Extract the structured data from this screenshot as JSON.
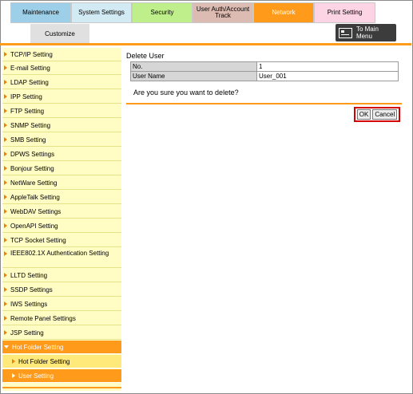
{
  "tabs": {
    "maintenance": "Maintenance",
    "system_settings": "System Settings",
    "security": "Security",
    "user_auth": "User Auth/Account Track",
    "network": "Network",
    "print_setting": "Print Setting"
  },
  "subtab": {
    "customize": "Customize"
  },
  "to_main_menu": "To Main Menu",
  "sidebar": {
    "items": [
      "TCP/IP Setting",
      "E-mail Setting",
      "LDAP Setting",
      "IPP Setting",
      "FTP Setting",
      "SNMP Setting",
      "SMB Setting",
      "DPWS Settings",
      "Bonjour Setting",
      "NetWare Setting",
      "AppleTalk Setting",
      "WebDAV Settings",
      "OpenAPI Setting",
      "TCP Socket Setting",
      "IEEE802.1X Authentication Setting",
      "LLTD Setting",
      "SSDP Settings",
      "IWS Settings",
      "Remote Panel Settings",
      "JSP Setting",
      "Hot Folder Setting"
    ],
    "sub_items": [
      "Hot Folder Setting",
      "User Setting"
    ]
  },
  "main": {
    "title": "Delete User",
    "table": [
      {
        "label": "No.",
        "value": "1"
      },
      {
        "label": "User Name",
        "value": "User_001"
      }
    ],
    "confirm_text": "Are you sure you want to delete?",
    "ok_label": "OK",
    "cancel_label": "Cancel"
  },
  "colors": {
    "accent": "#ff9a1a",
    "sidebar_bg": "#fffcc4",
    "highlight_border": "#d40000"
  }
}
